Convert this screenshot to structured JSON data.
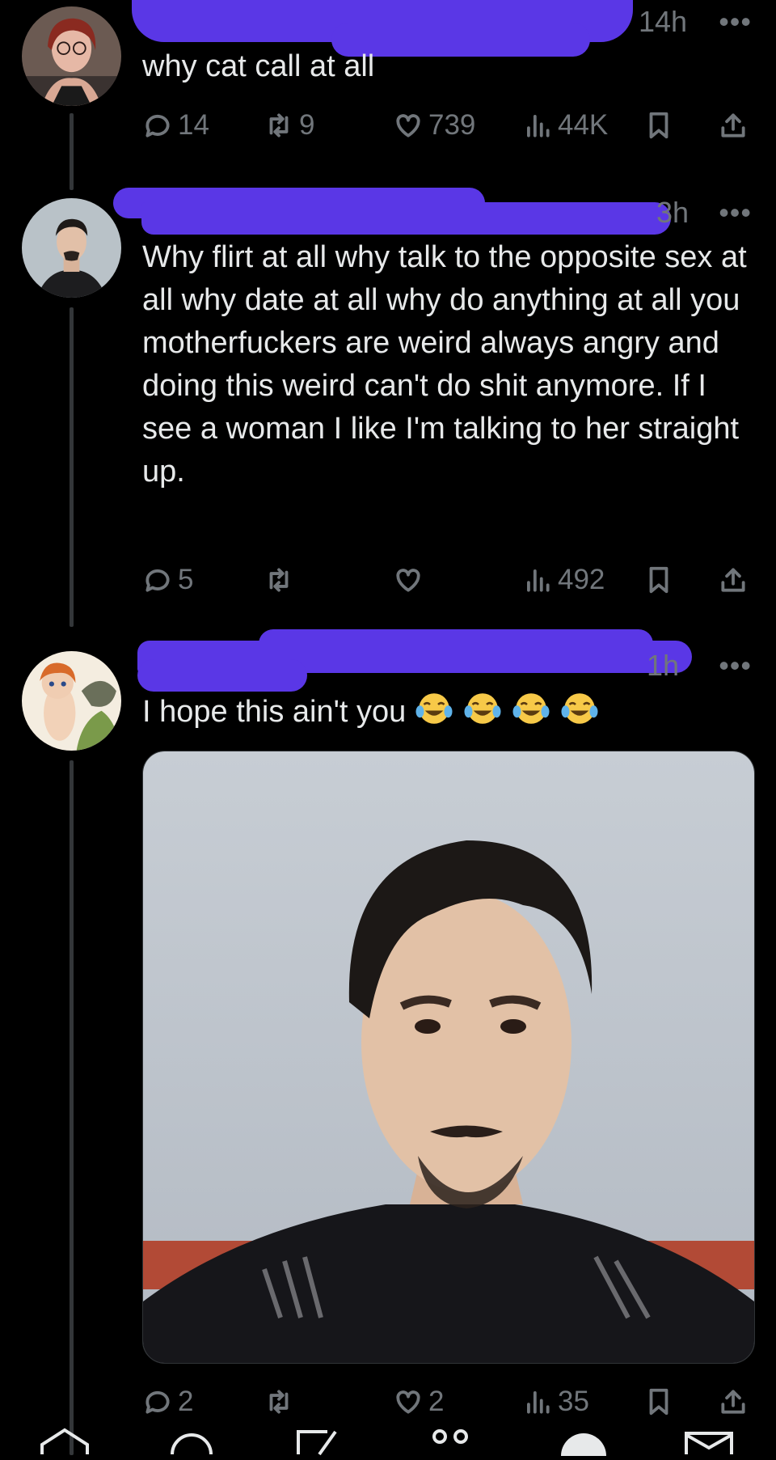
{
  "tweets": [
    {
      "time": "14h",
      "more": "•••",
      "text": "why cat call at all",
      "replies": "14",
      "retweets": "9",
      "likes": "739",
      "views": "44K"
    },
    {
      "time": "3h",
      "more": "•••",
      "text": "Why flirt at all why talk to the opposite sex at all why date at all why do anything at all you motherfuckers are weird always angry and doing this weird can't do shit anymore. If I see a woman I like I'm talking to her straight up.",
      "replies": "5",
      "retweets": "",
      "likes": "",
      "views": "492"
    },
    {
      "time": "1h",
      "more": "•••",
      "text": "I hope this ain't you",
      "emoji": [
        "face-with-tears-of-joy",
        "face-with-tears-of-joy",
        "face-with-tears-of-joy",
        "face-with-tears-of-joy"
      ],
      "replies": "2",
      "retweets": "",
      "likes": "2",
      "views": "35"
    }
  ],
  "icons": {
    "reply": "reply-icon",
    "retweet": "retweet-icon",
    "like": "like-icon",
    "views": "views-icon",
    "bookmark": "bookmark-icon",
    "share": "share-icon"
  },
  "colors": {
    "background": "#000000",
    "text": "#e7e9ea",
    "muted": "#71767b",
    "redaction": "#5a37e6"
  }
}
